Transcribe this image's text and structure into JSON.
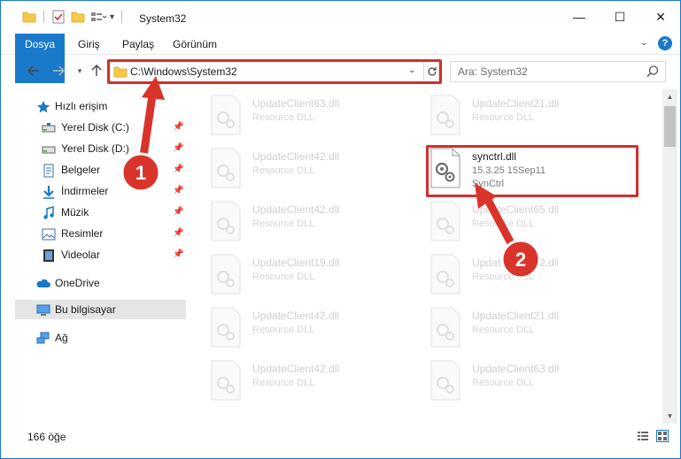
{
  "window": {
    "title": "System32",
    "minimize_glyph": "—",
    "maximize_glyph": "☐",
    "close_glyph": "✕"
  },
  "ribbon": {
    "tabs": [
      {
        "label": "Dosya",
        "active": true
      },
      {
        "label": "Giriş"
      },
      {
        "label": "Paylaş"
      },
      {
        "label": "Görünüm"
      }
    ]
  },
  "address": {
    "path": "C:\\Windows\\System32",
    "search_placeholder": "Ara: System32"
  },
  "navpane": {
    "items": [
      {
        "label": "Hızlı erişim",
        "icon": "star-icon",
        "pinned": false
      },
      {
        "label": "Yerel Disk (C:)",
        "icon": "drive-icon",
        "pinned": true
      },
      {
        "label": "Yerel Disk (D:)",
        "icon": "drive-icon",
        "pinned": true
      },
      {
        "label": "Belgeler",
        "icon": "documents-icon",
        "pinned": true
      },
      {
        "label": "İndirmeler",
        "icon": "downloads-icon",
        "pinned": true
      },
      {
        "label": "Müzik",
        "icon": "music-icon",
        "pinned": true
      },
      {
        "label": "Resimler",
        "icon": "pictures-icon",
        "pinned": true
      },
      {
        "label": "Videolar",
        "icon": "videos-icon",
        "pinned": true
      },
      {
        "label": "OneDrive",
        "icon": "onedrive-icon"
      },
      {
        "label": "Bu bilgisayar",
        "icon": "this-pc-icon",
        "selected": true
      },
      {
        "label": "Ağ",
        "icon": "network-icon"
      }
    ]
  },
  "files": [
    {
      "name": "UpdateClient63.dll",
      "type": "Resource DLL"
    },
    {
      "name": "UpdateClient21.dll",
      "type": "Resource DLL"
    },
    {
      "name": "UpdateClient42.dll",
      "type": "Resource DLL"
    },
    {
      "name": "synctrl.dll",
      "type": "15.3.25 15Sep11",
      "description": "SynCtrl",
      "highlighted": true
    },
    {
      "name": "UpdateClient42.dll",
      "type": "Resource DLL"
    },
    {
      "name": "UpdateClient65.dll",
      "type": "Resource DLL"
    },
    {
      "name": "UpdateClient19.dll",
      "type": "Resource DLL"
    },
    {
      "name": "UpdateClient42.dll",
      "type": "Resource DLL"
    },
    {
      "name": "UpdateClient42.dll",
      "type": "Resource DLL"
    },
    {
      "name": "UpdateClient21.dll",
      "type": "Resource DLL"
    },
    {
      "name": "UpdateClient42.dll",
      "type": "Resource DLL"
    },
    {
      "name": "UpdateClient63.dll",
      "type": "Resource DLL"
    }
  ],
  "status": {
    "item_count": "166 öğe"
  },
  "annotations": [
    {
      "number": "1",
      "color": "#d9342b"
    },
    {
      "number": "2",
      "color": "#d9342b"
    }
  ],
  "colors": {
    "accent": "#1979ca",
    "highlight_border": "#d32f2f"
  }
}
